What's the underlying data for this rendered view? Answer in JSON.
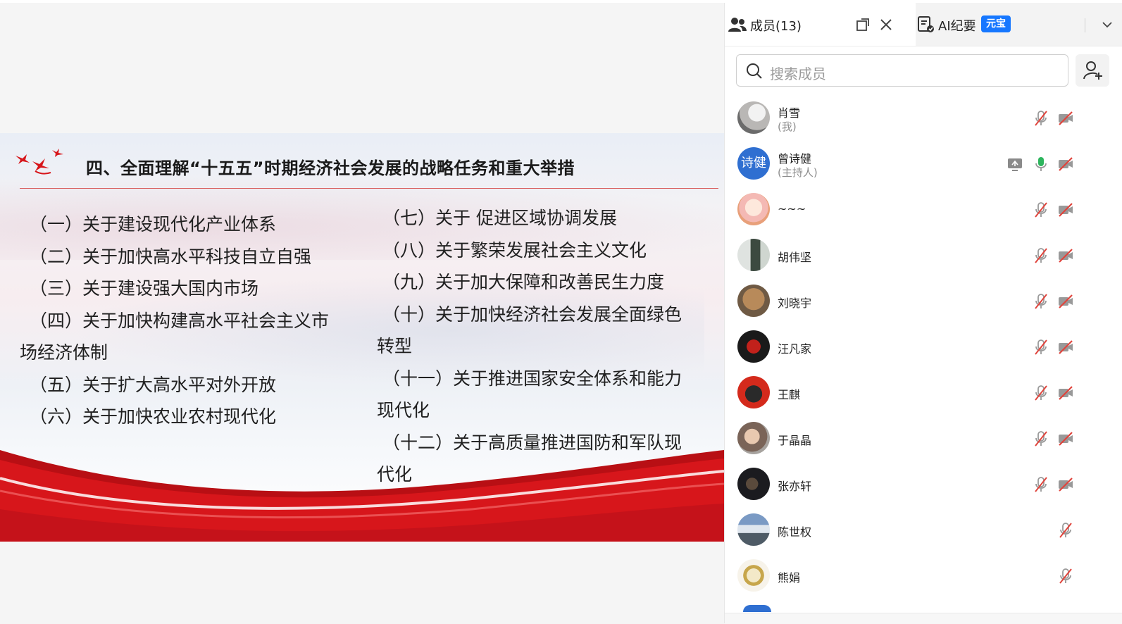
{
  "slide": {
    "title": "四、全面理解“十五五”时期经济社会发展的战略任务和重大举措",
    "left_items": [
      "（一）关于建设现代化产业体系",
      "（二）关于加快高水平科技自立自强",
      "（三）关于建设强大国内市场",
      "（四）关于加快构建高水平社会主义市",
      "场经济体制",
      "（五）关于扩大高水平对外开放",
      "（六）关于加快农业农村现代化"
    ],
    "right_items": [
      "（七）关于 促进区域协调发展",
      "（八）关于繁荣发展社会主义文化",
      "（九）关于加大保障和改善民生力度",
      "（十）关于加快经济社会发展全面绿色",
      "转型",
      "（十一）关于推进国家安全体系和能力",
      "现代化",
      "（十二）关于高质量推进国防和军队现",
      "代化"
    ]
  },
  "panel": {
    "members_tab": "成员(13)",
    "ai_tab": "AI纪要",
    "ai_badge": "元宝",
    "search_placeholder": "搜索成员",
    "members": [
      {
        "name": "肖雪",
        "role": "(我)",
        "mic": "muted",
        "video": "off"
      },
      {
        "name": "曾诗健",
        "role": "(主持人)",
        "avatar_text": "诗健",
        "screen_share": true,
        "mic": "on",
        "video": "off"
      },
      {
        "name": "~~~",
        "mic": "muted",
        "video": "off"
      },
      {
        "name": "胡伟坚",
        "mic": "muted",
        "video": "off"
      },
      {
        "name": "刘晓宇",
        "mic": "muted",
        "video": "off"
      },
      {
        "name": "汪凡家",
        "mic": "muted",
        "video": "off"
      },
      {
        "name": "王麒",
        "mic": "muted",
        "video": "off"
      },
      {
        "name": "于晶晶",
        "mic": "muted",
        "video": "off"
      },
      {
        "name": "张亦轩",
        "mic": "muted",
        "video": "off"
      },
      {
        "name": "陈世权",
        "mic": "muted"
      },
      {
        "name": "熊娟",
        "mic": "muted"
      }
    ]
  },
  "colors": {
    "accent_red": "#d7161b",
    "mute_red": "#e0443c",
    "mic_green": "#2db55d",
    "host_avatar": "#2f6fd1",
    "badge_blue": "#1677ff"
  }
}
